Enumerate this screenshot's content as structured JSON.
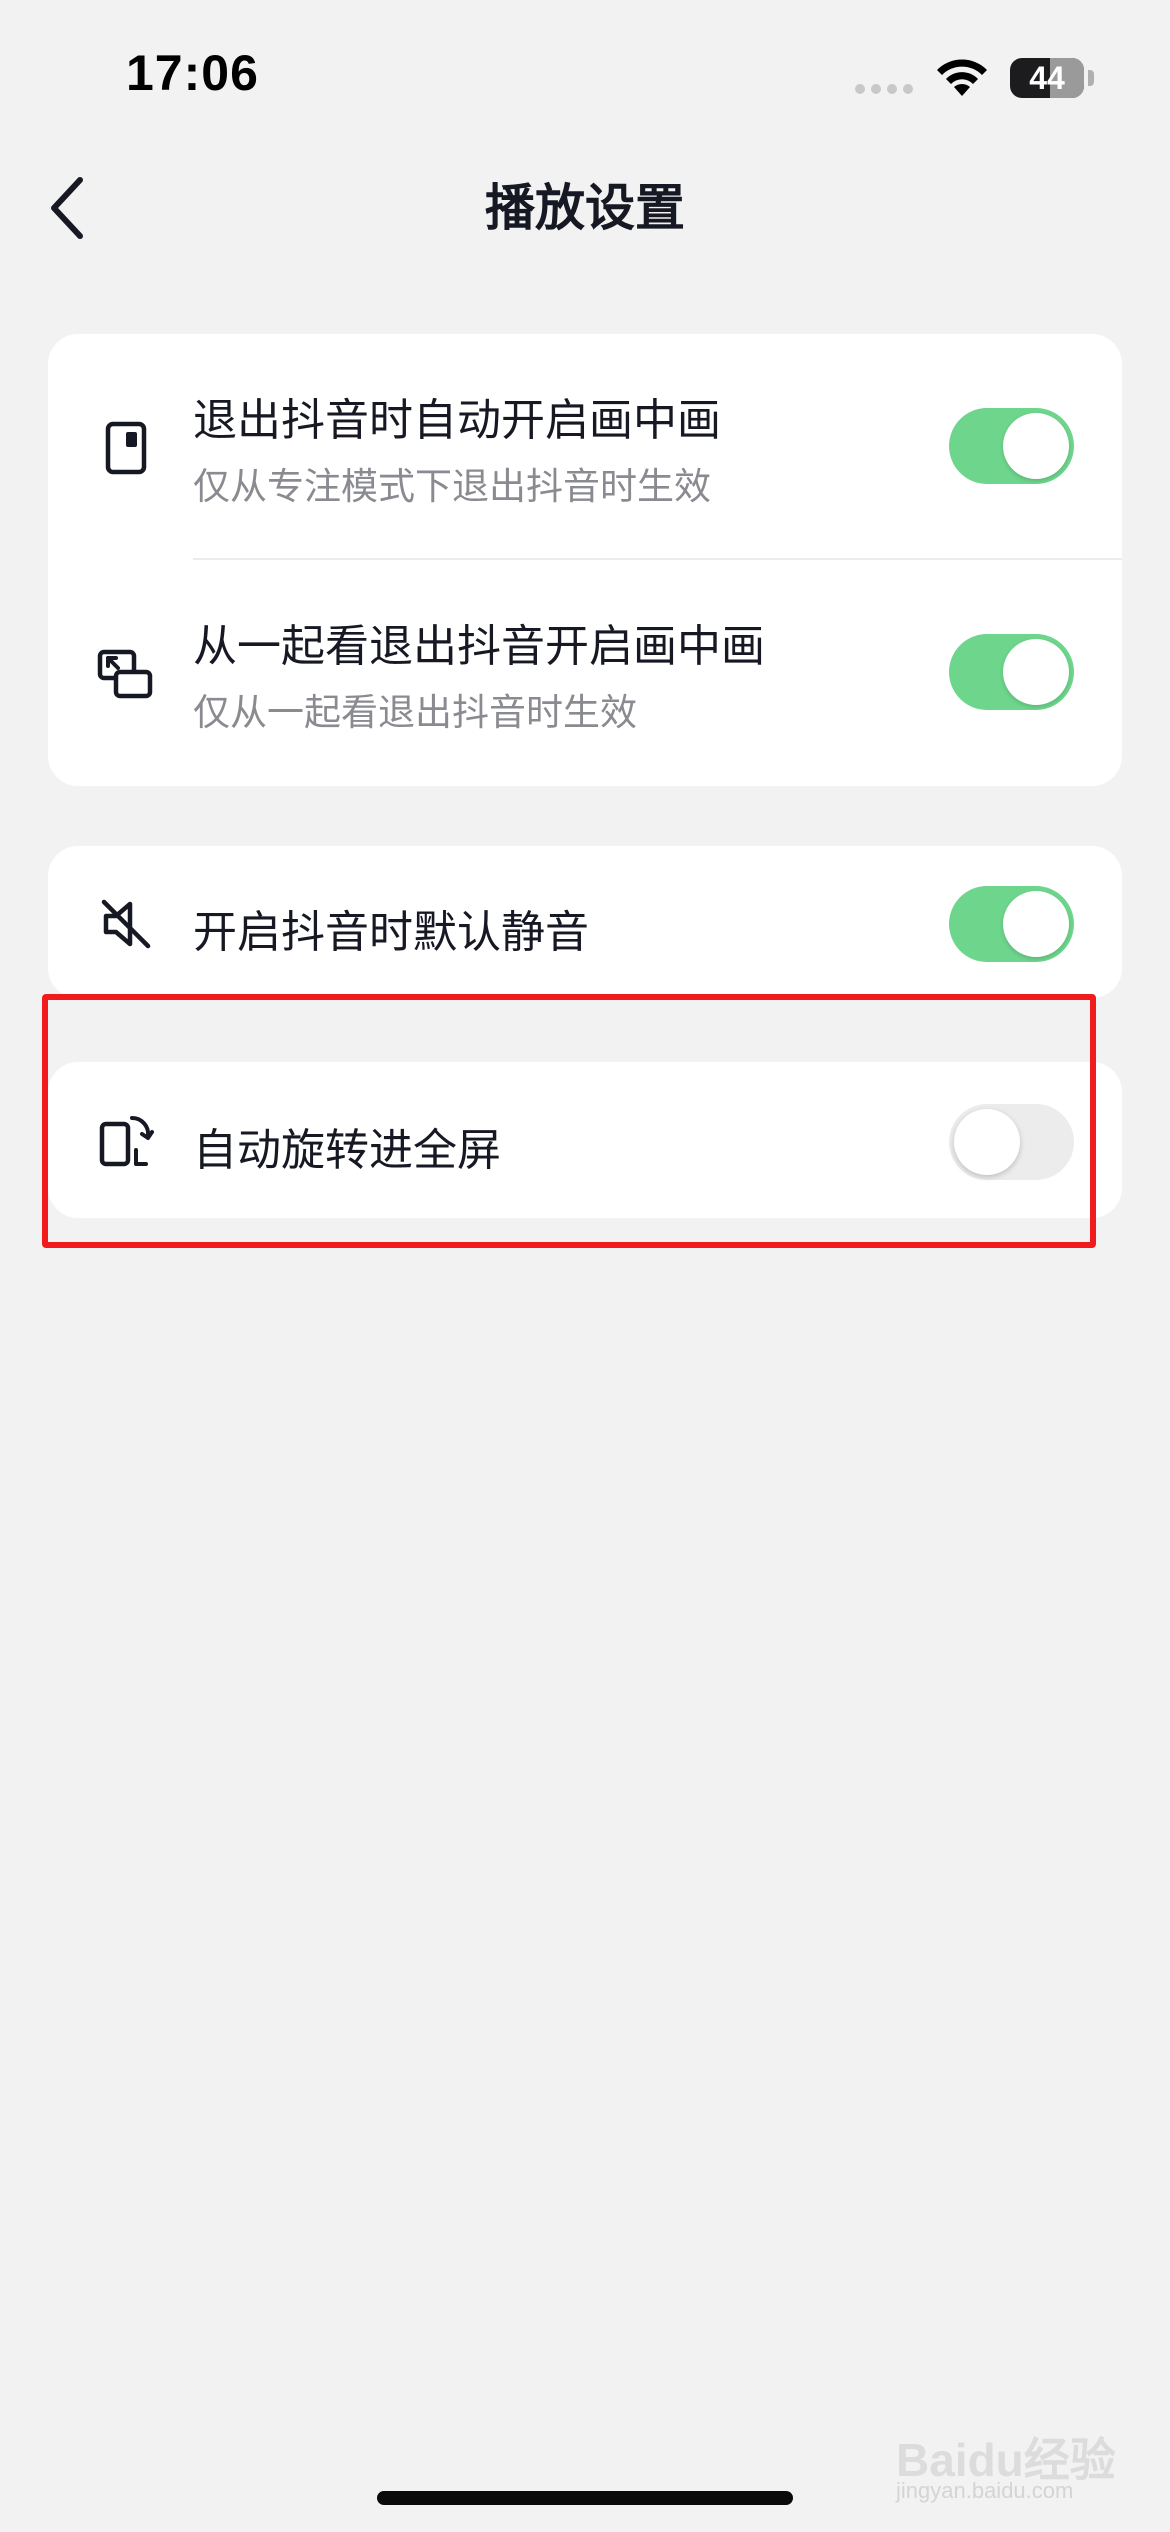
{
  "status_bar": {
    "time": "17:06",
    "battery": "44"
  },
  "nav": {
    "title": "播放设置",
    "back_icon": "chevron-left-icon"
  },
  "sections": [
    {
      "rows": [
        {
          "icon": "phone-pip-icon",
          "title": "退出抖音时自动开启画中画",
          "subtitle": "仅从专注模式下退出抖音时生效",
          "toggle_on": true
        },
        {
          "icon": "watch-together-pip-icon",
          "title": "从一起看退出抖音开启画中画",
          "subtitle": "仅从一起看退出抖音时生效",
          "toggle_on": true
        }
      ]
    },
    {
      "rows": [
        {
          "icon": "speaker-muted-icon",
          "title": "开启抖音时默认静音",
          "toggle_on": true
        }
      ]
    },
    {
      "rows": [
        {
          "icon": "rotate-screen-icon",
          "title": "自动旋转进全屏",
          "toggle_on": false
        }
      ]
    }
  ],
  "colors": {
    "background": "#f2f2f2",
    "card": "#ffffff",
    "toggle_on": "#6ed58c",
    "toggle_off": "#ececec",
    "highlight": "#f11b1b",
    "subtitle": "#8a8b91"
  },
  "watermark": {
    "brand": "Baidu经验",
    "url": "jingyan.baidu.com"
  }
}
